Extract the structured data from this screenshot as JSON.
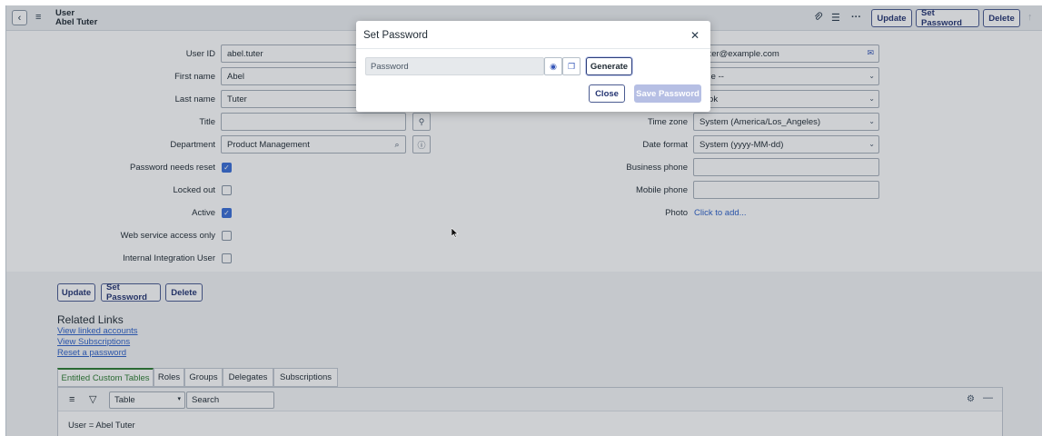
{
  "header": {
    "record_type": "User",
    "record_name": "Abel Tuter",
    "buttons": {
      "update": "Update",
      "set_password": "Set Password",
      "delete": "Delete"
    }
  },
  "form": {
    "left": {
      "user_id": {
        "label": "User ID",
        "value": "abel.tuter"
      },
      "first_name": {
        "label": "First name",
        "value": "Abel"
      },
      "last_name": {
        "label": "Last name",
        "value": "Tuter"
      },
      "title": {
        "label": "Title",
        "value": ""
      },
      "department": {
        "label": "Department",
        "value": "Product Management"
      },
      "password_needs_reset": {
        "label": "Password needs reset",
        "checked": true
      },
      "locked_out": {
        "label": "Locked out",
        "checked": false
      },
      "active": {
        "label": "Active",
        "checked": true
      },
      "web_service_access_only": {
        "label": "Web service access only",
        "checked": false
      },
      "internal_integration_user": {
        "label": "Internal Integration User",
        "checked": false
      }
    },
    "right": {
      "email": {
        "value": ".tuter@example.com"
      },
      "language": {
        "value": "lone --"
      },
      "calendar_integration": {
        "value": "tlook"
      },
      "time_zone": {
        "label": "Time zone",
        "value": "System (America/Los_Angeles)"
      },
      "date_format": {
        "label": "Date format",
        "value": "System (yyyy-MM-dd)"
      },
      "business_phone": {
        "label": "Business phone",
        "value": ""
      },
      "mobile_phone": {
        "label": "Mobile phone",
        "value": ""
      },
      "photo": {
        "label": "Photo",
        "link": "Click to add..."
      }
    }
  },
  "bottom_buttons": {
    "update": "Update",
    "set_password": "Set Password",
    "delete": "Delete"
  },
  "related_links": {
    "title": "Related Links",
    "items": [
      "View linked accounts",
      "View Subscriptions",
      "Reset a password"
    ]
  },
  "tabs": [
    "Entitled Custom Tables",
    "Roles",
    "Groups",
    "Delegates",
    "Subscriptions"
  ],
  "list": {
    "filter_select": "Table",
    "search_placeholder": "Search",
    "breadcrumb": "User = Abel Tuter"
  },
  "modal": {
    "title": "Set Password",
    "password_placeholder": "Password",
    "generate": "Generate",
    "close": "Close",
    "save": "Save Password"
  }
}
